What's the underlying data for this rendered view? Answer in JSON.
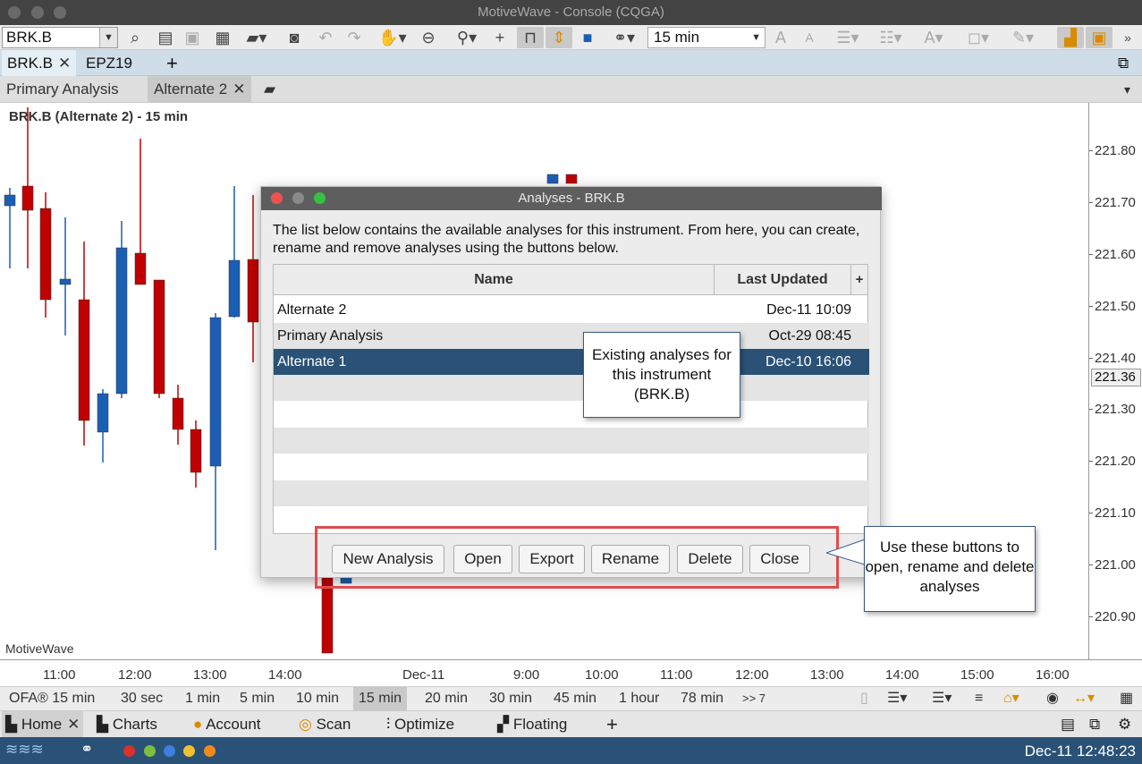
{
  "window": {
    "title": "MotiveWave - Console (CQGA)"
  },
  "toolbar": {
    "symbol": "BRK.B",
    "bar_size": "15 min"
  },
  "tabs": [
    {
      "label": "BRK.B"
    },
    {
      "label": "EPZ19"
    }
  ],
  "analysis_tabs": [
    {
      "label": "Primary Analysis"
    },
    {
      "label": "Alternate 2"
    }
  ],
  "chart": {
    "title": "BRK.B (Alternate 2) - 15 min",
    "watermark": "MotiveWave",
    "y_ticks": [
      "221.80",
      "221.70",
      "221.60",
      "221.50",
      "221.40",
      "221.30",
      "221.20",
      "221.10",
      "221.00",
      "220.90"
    ],
    "price_tag": "221.36",
    "x_ticks": [
      "11:00",
      "12:00",
      "13:00",
      "14:00",
      "Dec-11",
      "9:00",
      "10:00",
      "11:00",
      "12:00",
      "13:00",
      "14:00",
      "15:00",
      "16:00"
    ],
    "up_color": "#1a5fb4",
    "down_color": "#c00000"
  },
  "bar_sizes": [
    "OFA® 15 min",
    "30 sec",
    "1 min",
    "5 min",
    "10 min",
    "15 min",
    "20 min",
    "30 min",
    "45 min",
    "1 hour",
    "78 min",
    ">> 7"
  ],
  "home_tabs": [
    {
      "label": "Home"
    },
    {
      "label": "Charts"
    },
    {
      "label": "Account"
    },
    {
      "label": "Scan"
    },
    {
      "label": "Optimize"
    },
    {
      "label": "Floating"
    }
  ],
  "status": {
    "datetime": "Dec-11 12:48:23",
    "dot_colors": [
      "#d9322b",
      "#7cbf3d",
      "#3d7fe0",
      "#f2c12e",
      "#f08a1c"
    ]
  },
  "dialog": {
    "title": "Analyses - BRK.B",
    "description": "The list below contains the available analyses for this instrument.  From here, you can create, rename and remove analyses using the buttons below.",
    "columns": {
      "name": "Name",
      "updated": "Last Updated",
      "add": "+"
    },
    "rows": [
      {
        "name": "Alternate 2",
        "updated": "Dec-11 10:09"
      },
      {
        "name": "Primary Analysis",
        "updated": "Oct-29 08:45"
      },
      {
        "name": "Alternate 1",
        "updated": "Dec-10 16:06"
      }
    ],
    "buttons": {
      "new": "New Analysis",
      "open": "Open",
      "export": "Export",
      "rename": "Rename",
      "delete": "Delete",
      "close": "Close"
    }
  },
  "callouts": {
    "existing": "Existing analyses for this instrument (BRK.B)",
    "buttons": "Use these buttons to open, rename and delete analyses"
  }
}
